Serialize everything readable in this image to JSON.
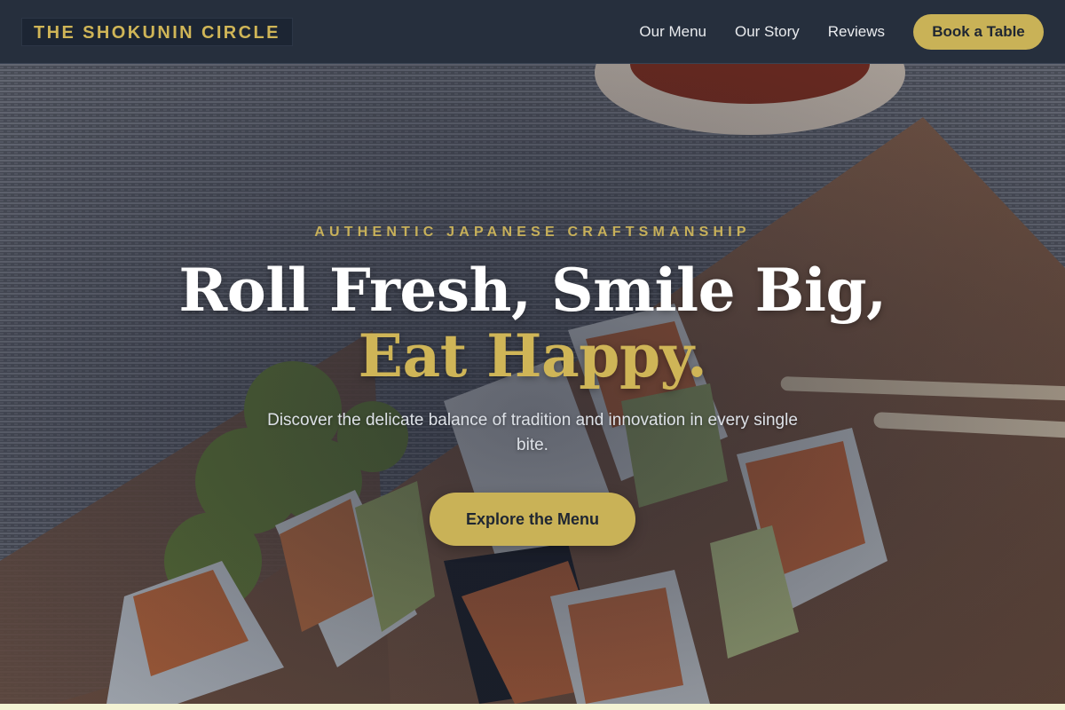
{
  "nav": {
    "brand": "THE SHOKUNIN CIRCLE",
    "links": [
      {
        "label": "Our Menu"
      },
      {
        "label": "Our Story"
      },
      {
        "label": "Reviews"
      }
    ],
    "cta_label": "Book a Table"
  },
  "hero": {
    "eyebrow": "AUTHENTIC JAPANESE CRAFTSMANSHIP",
    "headline_line1": "Roll Fresh, Smile Big,",
    "headline_line2": "Eat Happy.",
    "subtext": "Discover the delicate balance of tradition and innovation in every single bite.",
    "cta_label": "Explore the Menu",
    "background_image": "sushi-rolls-on-wooden-board-photo"
  },
  "colors": {
    "nav_bg": "#262f3d",
    "accent_gold": "#c9b257",
    "text_light": "#ffffff"
  }
}
